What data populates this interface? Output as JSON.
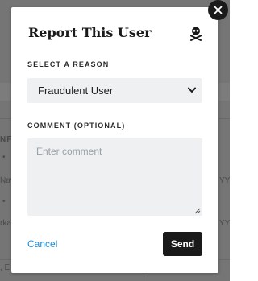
{
  "modal": {
    "title": "Report This User",
    "reason_label": "SELECT A REASON",
    "reason_selected": "Fraudulent User",
    "comment_label": "COMMENT (OPTIONAL)",
    "comment_placeholder": "Enter comment",
    "cancel_label": "Cancel",
    "send_label": "Send",
    "close_icon": "close-icon",
    "title_icon": "skull-crossbones-icon"
  },
  "background": {
    "left_fragments": [
      "NFC",
      "•",
      "Nav",
      "•",
      "rka",
      ", E"
    ],
    "right_fragments": [
      "YY",
      "YY"
    ]
  },
  "colors": {
    "accent": "#1a8fd6",
    "primary_button": "#1a1a1a",
    "field_bg": "#eff0f2",
    "overlay": "#757575"
  }
}
